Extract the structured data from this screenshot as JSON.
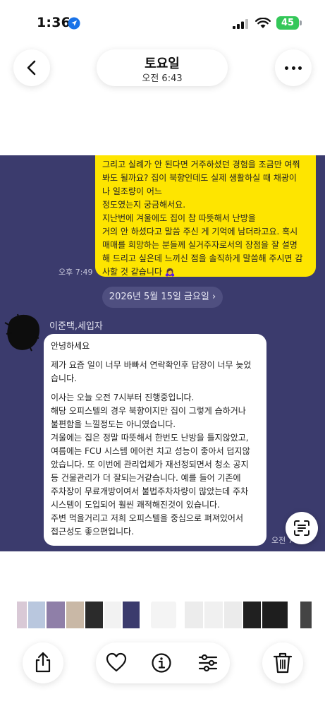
{
  "status_bar": {
    "time": "1:36",
    "battery": "45",
    "icons": [
      "location-arrow-icon",
      "cellular-signal-icon",
      "wifi-icon",
      "battery-icon"
    ],
    "battery_color": "#34c759"
  },
  "header": {
    "title": "토요일",
    "subtitle": "오전 6:43",
    "icons": [
      "back-chevron-icon",
      "more-dots-icon"
    ]
  },
  "chat": {
    "background_color": "#3b3b6d",
    "sent_bubble_color": "#fee500",
    "sent_message_lines": [
      "그리고 실례가 안 된다면 거주하셨던 경험을 조금만 여쭤",
      "봐도 될까요? 집이 북향인데도 실제 생활하실 때 채광이",
      "나 일조량이 어느",
      "정도였는지 궁금해서요.",
      "지난번에 겨울에도 집이 참 따뜻해서 난방을",
      "거의 안 하셨다고 말씀 주신 게 기억에 남더라고요. 혹시",
      "매매를 희망하는 분들께 실거주자로서의 장점을 잘 설명",
      "해 드리고 싶은데 느끼신 점을 솔직하게 말씀해 주시면 감",
      "사할 것 같습니다 🙇‍♀️"
    ],
    "sent_time": "오후 7:49",
    "date_divider": "2026년 5월 15일 금요일",
    "date_divider_chevron": "›",
    "sender_name": "이준택,세입자",
    "received_paragraphs": [
      [
        "안녕하세요"
      ],
      [
        "제가 요즘 일이 너무 바빠서 연락확인후 답장이 너무 늦었",
        "습니다."
      ],
      [
        "이사는 오늘 오전 7시부터 진행중입니다.",
        "해당 오피스텔의 경우 북향이지만 집이 그렇게 습하거나",
        "불편함을 느낄정도는 아니였습니다.",
        "겨울에는 집은 정말 따뜻해서 한번도 난방을 틀지않았고,",
        "여름에는 FCU 시스템 에어컨 치고 성능이 좋아서 덥지않",
        "았습니다. 또 이번에 관리업체가 재선정되면서 청소 공지",
        "등 건물관리가 더 잘되는거같습니다. 예를 들어 기존에",
        "주차장이 무료개방이여서 불법주차차량이 많았는데 주차",
        "시스템이 도입되어 훨씬 쾌적해진것이 있습니다.",
        "주변 먹을거리고 저희 오피스텔을 중심으로 펴져있어서",
        "접근성도 좋으편입니다."
      ]
    ],
    "received_time": "오전 7",
    "ocr_icon": "live-text-scan-icon"
  },
  "thumbnails": {
    "count": 14,
    "colors": [
      "#d9c9d6",
      "#b9c7de",
      "#8f7fa8",
      "#c9b8a6",
      "#2b2b2b",
      "#f2f2f2",
      "#3b3b6d",
      "#f4f4f4",
      "#ececec",
      "#f0f0f0",
      "#ebebeb",
      "#202020",
      "#1e1e1e",
      "#444444"
    ]
  },
  "toolbar": {
    "icons": [
      "share-icon",
      "heart-icon",
      "info-icon",
      "adjust-sliders-icon",
      "trash-icon"
    ]
  }
}
